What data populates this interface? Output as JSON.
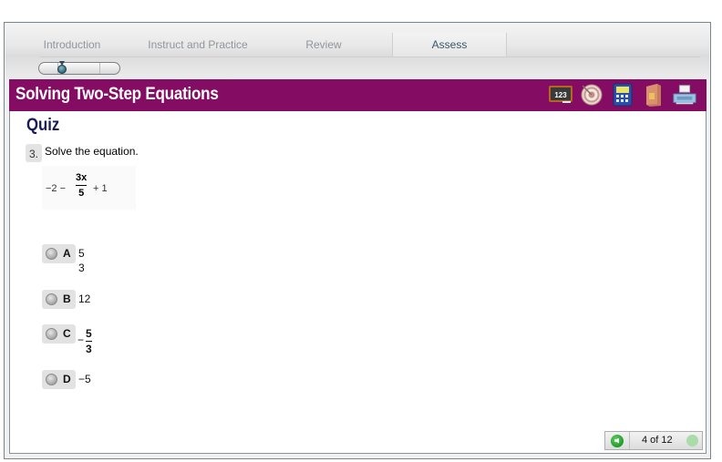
{
  "nav": {
    "tabs": [
      {
        "label": "Introduction",
        "active": false
      },
      {
        "label": "Instruct and Practice",
        "active": false
      },
      {
        "label": "Review",
        "active": false
      },
      {
        "label": "Assess",
        "active": true
      }
    ],
    "progress_slider_position": 0.25
  },
  "header": {
    "title": "Solving Two-Step Equations",
    "accent_color": "#840c63",
    "tools": [
      {
        "name": "chalkboard-123-icon",
        "label": "123"
      },
      {
        "name": "target-icon"
      },
      {
        "name": "calculator-icon"
      },
      {
        "name": "book-icon"
      },
      {
        "name": "printer-icon"
      }
    ]
  },
  "quiz": {
    "title": "Quiz",
    "question_number": "3.",
    "question_text": "Solve the equation.",
    "equation": {
      "lhs": "−2 −",
      "frac_num": "3x",
      "frac_den": "5",
      "rhs": "+ 1"
    },
    "choices": [
      {
        "letter": "A",
        "type": "fraction",
        "num": "5",
        "den": "3",
        "sign": ""
      },
      {
        "letter": "B",
        "type": "number",
        "value": "12"
      },
      {
        "letter": "C",
        "type": "fraction",
        "num": "5",
        "den": "3",
        "sign": "−"
      },
      {
        "letter": "D",
        "type": "number",
        "value": "−5"
      }
    ]
  },
  "footer": {
    "page_indicator": "4 of 12",
    "audio_icon": "speaker-icon",
    "next_icon": "next-icon"
  }
}
